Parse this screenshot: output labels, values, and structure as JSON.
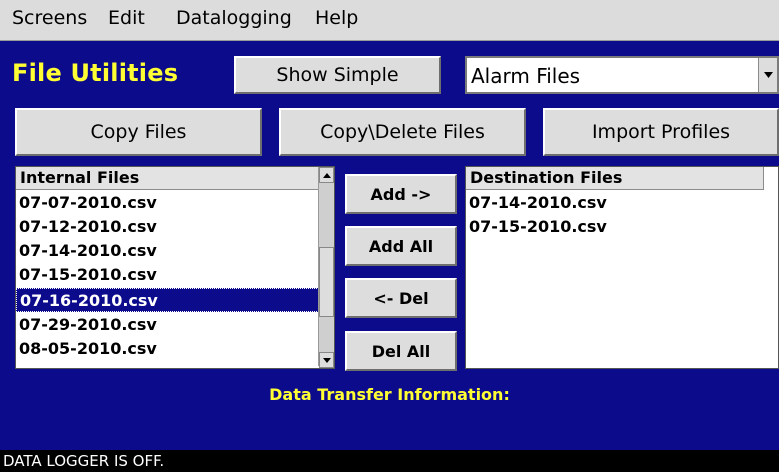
{
  "menu": [
    "Screens",
    "Edit",
    "Datalogging",
    "Help"
  ],
  "title": "File Utilities",
  "buttons": {
    "show_simple": "Show Simple",
    "copy_files": "Copy Files",
    "copy_delete_files": "Copy\\Delete Files",
    "import_profiles": "Import Profiles",
    "add": "Add ->",
    "add_all": "Add All",
    "del": "<- Del",
    "del_all": "Del All"
  },
  "file_type_select": {
    "value": "Alarm Files"
  },
  "internal_files": {
    "header": "Internal Files",
    "items": [
      "07-07-2010.csv",
      "07-12-2010.csv",
      "07-14-2010.csv",
      "07-15-2010.csv",
      "07-16-2010.csv",
      "07-29-2010.csv",
      "08-05-2010.csv"
    ],
    "selected_index": 4
  },
  "destination_files": {
    "header": "Destination Files",
    "items": [
      "07-14-2010.csv",
      "07-15-2010.csv"
    ]
  },
  "info_label": "Data Transfer Information:",
  "status": "DATA LOGGER IS OFF.",
  "colors": {
    "background": "#0b0b8c",
    "title": "#ffff33",
    "selection": "#0b0b8c"
  },
  "icons": {
    "scroll_up": "triangle-up-icon",
    "scroll_down": "triangle-down-icon",
    "dropdown": "triangle-down-icon"
  }
}
